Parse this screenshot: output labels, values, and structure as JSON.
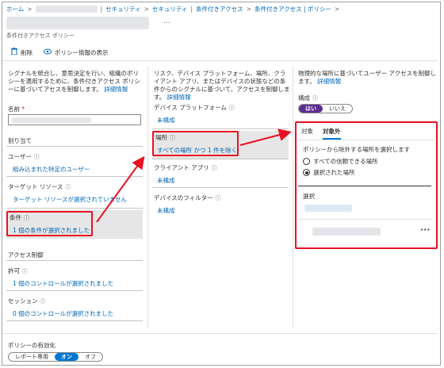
{
  "breadcrumb": {
    "home": "ホーム",
    "sep": ">",
    "bar": "|",
    "security1": "セキュリティ",
    "security2": "セキュリティ",
    "ca": "条件付きアクセス",
    "policy": "条件付きアクセス | ポリシー"
  },
  "header": {
    "more": "...",
    "subtitle": "条件付きアクセス ポリシー"
  },
  "toolbar": {
    "delete": "削除",
    "view_info": "ポリシー情報の表示"
  },
  "left": {
    "description": "シグナルを統合し、意思決定を行い、組織のポリシーを適用するために、条件付きアクセス ポリシーに基づいてアセスを制御します。",
    "details_link": "詳細情報",
    "name_label": "名前",
    "required_mark": "*",
    "assignments": "割り当て",
    "users_label": "ユーザー",
    "users_value": "組み込まれた特定のユーザー",
    "targets_label": "ターゲット リソース",
    "targets_value": "ターゲット リソースが選択されていません",
    "conditions_label": "条件",
    "conditions_value": "1 個の条件が選択されました",
    "access_controls": "アクセス制御",
    "grant_label": "許可",
    "grant_value": "1 個のコントロールが選択されました",
    "session_label": "セッション",
    "session_value": "0 個のコントロールが選択されました"
  },
  "middle": {
    "description": "リスク、デバイス プラットフォーム、場所、クライアント アプリ、またはデバイスの状態などの条件からのシグナルに基づいて、アクセスを制御します。",
    "details_link": "詳細情報",
    "device_platform_label": "デバイス プラットフォーム",
    "device_platform_value": "未構成",
    "location_label": "場所",
    "location_value": "すべての場所 かつ 1 件を除く",
    "client_apps_label": "クライアント アプリ",
    "client_apps_value": "未構成",
    "device_filter_label": "デバイスのフィルター",
    "device_filter_value": "未構成"
  },
  "right": {
    "description": "物理的な場所に基づいてユーザー アクセスを制御します。",
    "details_link": "詳細情報",
    "config_label": "構成",
    "yes": "はい",
    "no": "いいえ",
    "tab_include": "対象",
    "tab_exclude": "対象外",
    "exclude_prompt": "ポリシーから除外する場所を選択します",
    "option_trusted": "すべての信頼できる場所",
    "option_selected": "選択された場所",
    "select_label": "選択",
    "more": "•••"
  },
  "footer": {
    "enable_label": "ポリシーの有効化",
    "report_only": "レポート専用",
    "on": "オン",
    "off": "オフ"
  },
  "icon_info": "ⓘ",
  "colors": {
    "link": "#0067b8",
    "highlight": "#e81123",
    "toggle_purple": "#5c2d91",
    "toggle_blue": "#0078d4"
  }
}
